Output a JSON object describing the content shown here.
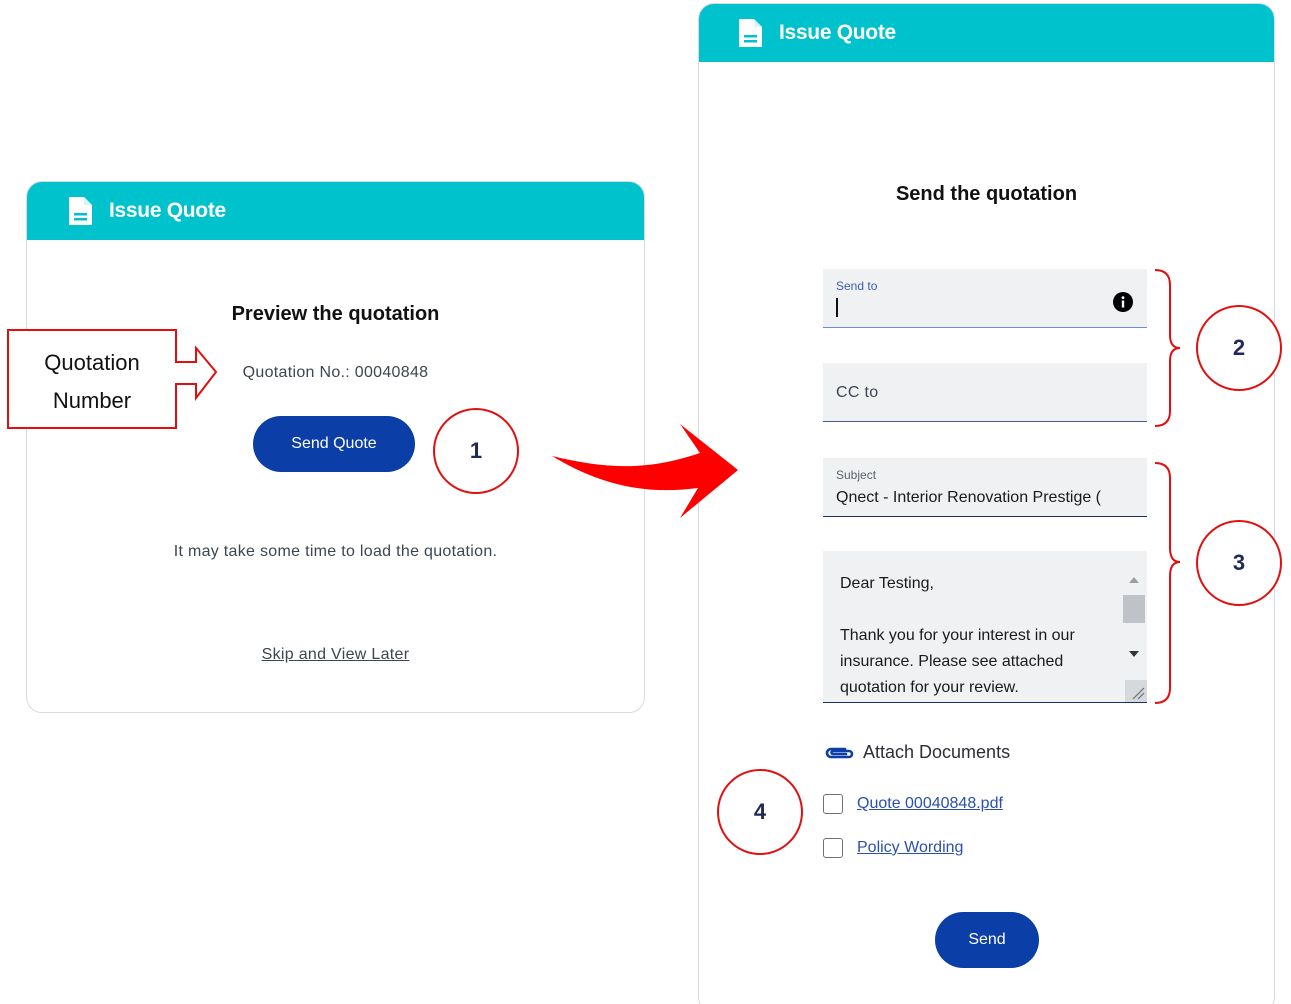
{
  "left_card": {
    "header_title": "Issue Quote",
    "heading": "Preview the quotation",
    "quotation_number": "Quotation No.: 00040848",
    "send_quote_label": "Send Quote",
    "load_note": "It may take some time to load the quotation.",
    "skip_link": "Skip and View Later"
  },
  "right_card": {
    "header_title": "Issue Quote",
    "heading": "Send the quotation",
    "send_to": {
      "label": "Send to",
      "value": ""
    },
    "cc_to": {
      "placeholder": "CC to"
    },
    "subject": {
      "label": "Subject",
      "value": "Qnect - Interior Renovation Prestige ("
    },
    "message": {
      "line1": "Dear Testing,",
      "line2": "Thank you for your interest in our insurance. Please see attached quotation for your review."
    },
    "attach_label": "Attach Documents",
    "attachments": [
      {
        "label": "Quote 00040848.pdf",
        "checked": false
      },
      {
        "label": "Policy Wording",
        "checked": false
      }
    ],
    "send_label": "Send"
  },
  "annotations": {
    "callout": {
      "line1": "Quotation",
      "line2": "Number"
    },
    "steps": [
      "1",
      "2",
      "3",
      "4"
    ]
  },
  "colors": {
    "header_teal": "#00c2cc",
    "primary_button": "#0b3ea6",
    "annotation_red": "#e01010",
    "link_blue": "#2a4fb0"
  },
  "icons": {
    "header": "document-icon",
    "send_to_info": "info-icon",
    "attach": "paperclip-icon",
    "arrow": "curved-arrow-icon"
  }
}
